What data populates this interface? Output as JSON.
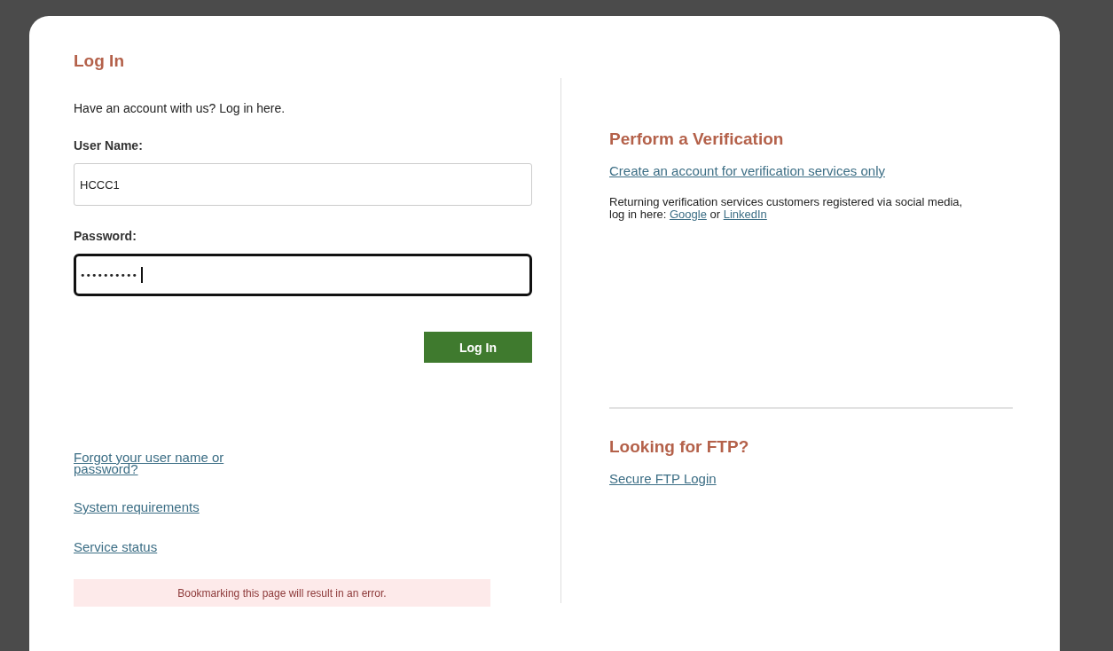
{
  "login": {
    "title": "Log In",
    "intro": "Have an account with us? Log in here.",
    "fields": [
      {
        "label": "User Name:",
        "value": "HCCC1",
        "focused": false
      },
      {
        "label": "Password:",
        "value": "••••••••••",
        "focused": true
      }
    ],
    "button": "Log In",
    "links": [
      "Forgot your user name or password?",
      "System requirements",
      "Service status"
    ],
    "notice": "Bookmarking this page will result in an error."
  },
  "verification": {
    "title": "Perform a Verification",
    "create_link": "Create an account for verification services only",
    "social": {
      "text": "Returning verification services customers registered via social media, log in here:",
      "links": [
        "Google",
        "LinkedIn"
      ],
      "separator": "or"
    }
  },
  "ftp": {
    "title": "Looking for FTP?",
    "link": "Secure FTP Login"
  }
}
